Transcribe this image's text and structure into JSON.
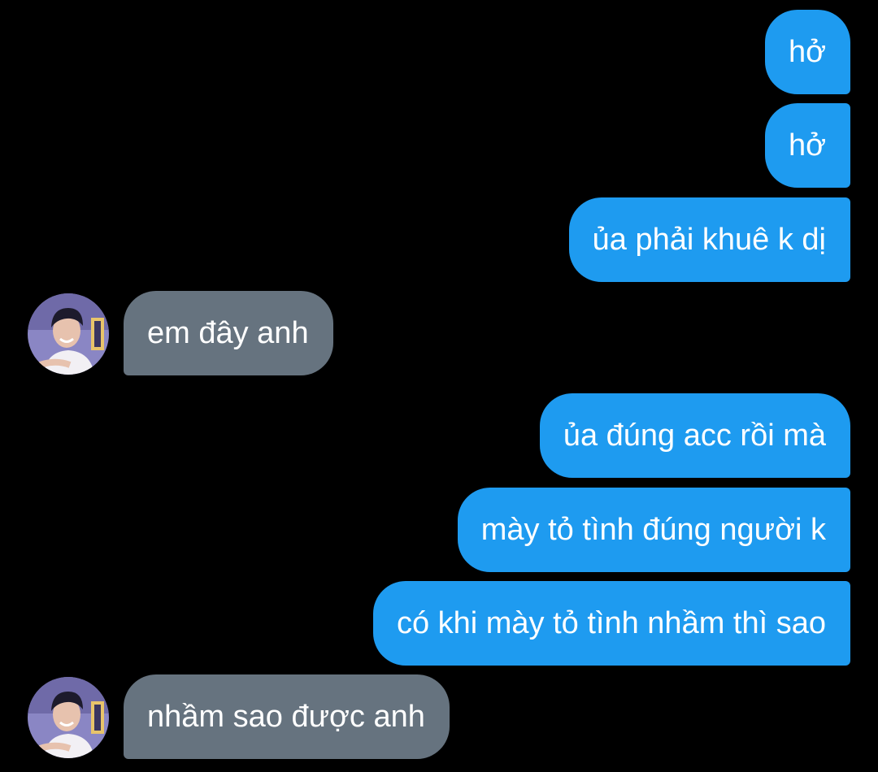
{
  "messages": [
    {
      "from": "me",
      "text": "hở"
    },
    {
      "from": "me",
      "text": "hở"
    },
    {
      "from": "me",
      "text": "ủa phải khuê k dị"
    },
    {
      "from": "other",
      "text": "em đây anh"
    },
    {
      "from": "me",
      "text": "ủa đúng acc rồi mà"
    },
    {
      "from": "me",
      "text": "mày tỏ tình đúng người k"
    },
    {
      "from": "me",
      "text": "có khi mày tỏ tình nhầm thì sao"
    },
    {
      "from": "other",
      "text": "nhầm sao được anh"
    }
  ],
  "colors": {
    "background": "#000000",
    "outgoing_bubble": "#1e9bf0",
    "incoming_bubble": "#66737f",
    "text": "#ffffff"
  },
  "icons": {
    "contact_avatar": "avatar-photo"
  }
}
